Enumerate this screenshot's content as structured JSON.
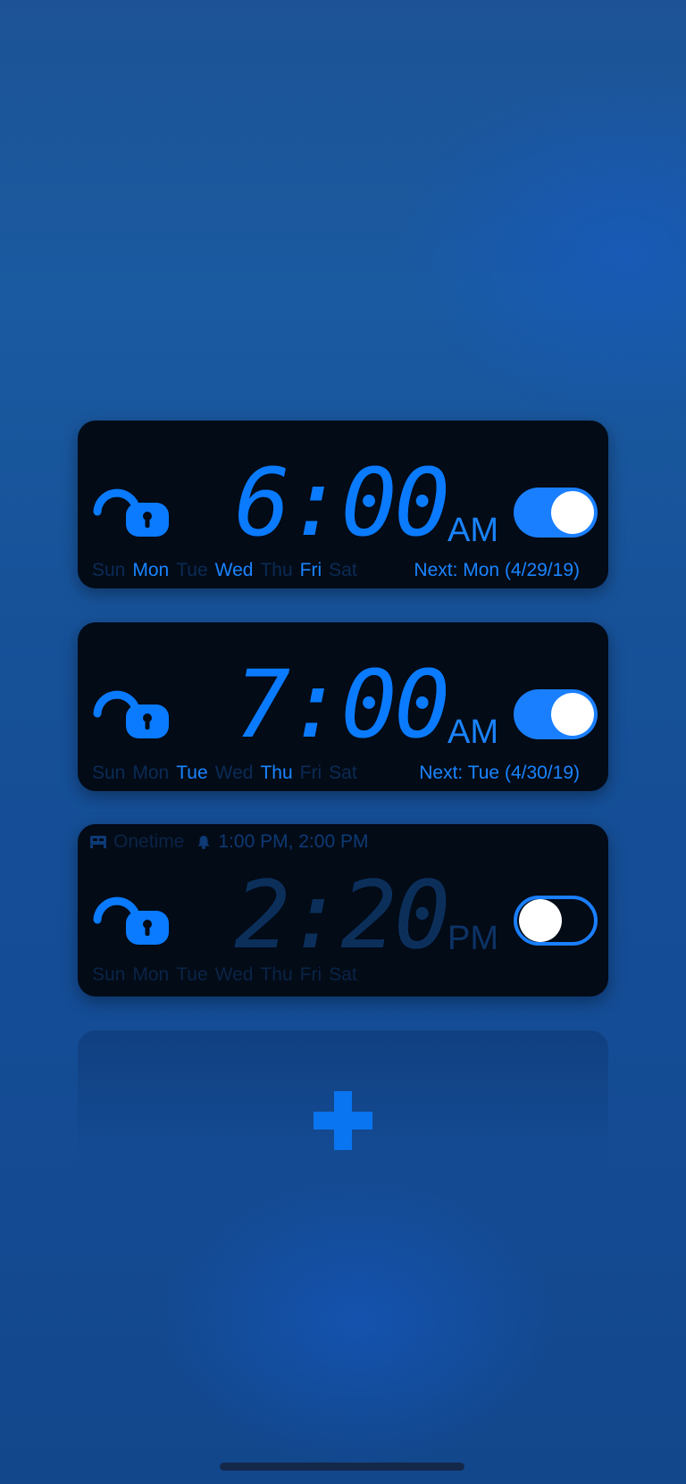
{
  "colors": {
    "accent": "#1a84ff",
    "card_background": "#030b17",
    "inactive_day": "#0b2b55"
  },
  "alarms": [
    {
      "time": "6:00",
      "ampm": "AM",
      "enabled": true,
      "lock_icon": "unlock-icon",
      "days": [
        "Sun",
        "Mon",
        "Tue",
        "Wed",
        "Thu",
        "Fri",
        "Sat"
      ],
      "active_days": [
        "Mon",
        "Wed",
        "Fri"
      ],
      "next": "Next: Mon (4/29/19)"
    },
    {
      "time": "7:00",
      "ampm": "AM",
      "enabled": true,
      "lock_icon": "unlock-icon",
      "days": [
        "Sun",
        "Mon",
        "Tue",
        "Wed",
        "Thu",
        "Fri",
        "Sat"
      ],
      "active_days": [
        "Tue",
        "Thu"
      ],
      "next": "Next: Tue (4/30/19)"
    },
    {
      "time": "2:20",
      "ampm": "PM",
      "enabled": false,
      "lock_icon": "unlock-icon",
      "header_label_dim": "Onetime",
      "header_snooze": "1:00 PM, 2:00 PM",
      "days": [
        "Sun",
        "Mon",
        "Tue",
        "Wed",
        "Thu",
        "Fri",
        "Sat"
      ],
      "active_days": []
    }
  ],
  "add_button_icon": "plus-icon"
}
